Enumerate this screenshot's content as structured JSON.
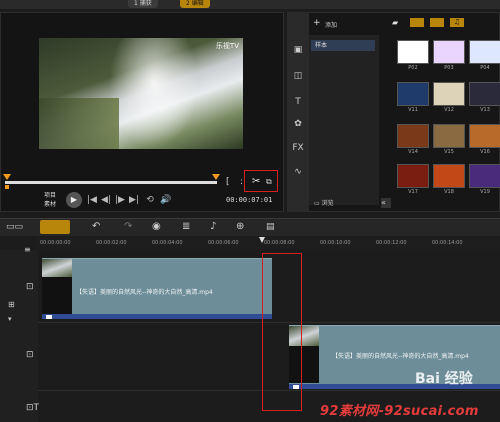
{
  "top_tabs": [
    {
      "label": "1 捕获",
      "active": false
    },
    {
      "label": "2 编辑",
      "active": true
    }
  ],
  "preview": {
    "watermark": "乐视TV",
    "mode_label": "项目",
    "mode_label2": "素材",
    "timecode": "00:00:07:01",
    "controls": [
      "|◀",
      "◀|",
      "|▶",
      "▶|",
      "⟲",
      "🔊"
    ],
    "play_icon": "play-icon"
  },
  "library": {
    "add_label": "添加",
    "folder": "样本",
    "browse_label": "浏览",
    "collapse": "«",
    "sidebar_icons": [
      "media-icon",
      "transition-icon",
      "title-icon",
      "graphic-icon",
      "fx-icon",
      "path-icon"
    ],
    "thumbnails": [
      {
        "label": "P02",
        "color": "#ffffff"
      },
      {
        "label": "P03",
        "color": "#e9d5ff"
      },
      {
        "label": "P04",
        "color": "#dde7ff"
      },
      {
        "label": "V11",
        "color": "#1e3b6b"
      },
      {
        "label": "V12",
        "color": "#dcd3b8"
      },
      {
        "label": "V13",
        "color": "#2a2a3a"
      },
      {
        "label": "V14",
        "color": "#7a3a1a"
      },
      {
        "label": "V15",
        "color": "#8a6a40"
      },
      {
        "label": "V16",
        "color": "#b86a2a"
      },
      {
        "label": "V17",
        "color": "#7a1e12"
      },
      {
        "label": "V18",
        "color": "#c24818"
      },
      {
        "label": "V19",
        "color": "#4a2a7a"
      }
    ]
  },
  "ruler": [
    "00:00:00:00",
    "00:00:02:00",
    "00:00:04:00",
    "00:00:06:00",
    "00:00:08:00",
    "00:00:10:00",
    "00:00:12:00",
    "00:00:14:00"
  ],
  "clips": {
    "clip1": "【失语】美丽的自然风光--神奇的大自然_高清.mp4",
    "clip2": "【失语】美丽的自然风光--神奇的大自然_高清.mp4"
  },
  "watermarks": {
    "baidu": "Bai 经验",
    "site": "92素材网-92sucai.com"
  },
  "colors": {
    "accent": "#f39a1e",
    "highlight_red": "#d62020",
    "clip": "#6d8e99",
    "clip_blue": "#2f4c94"
  }
}
